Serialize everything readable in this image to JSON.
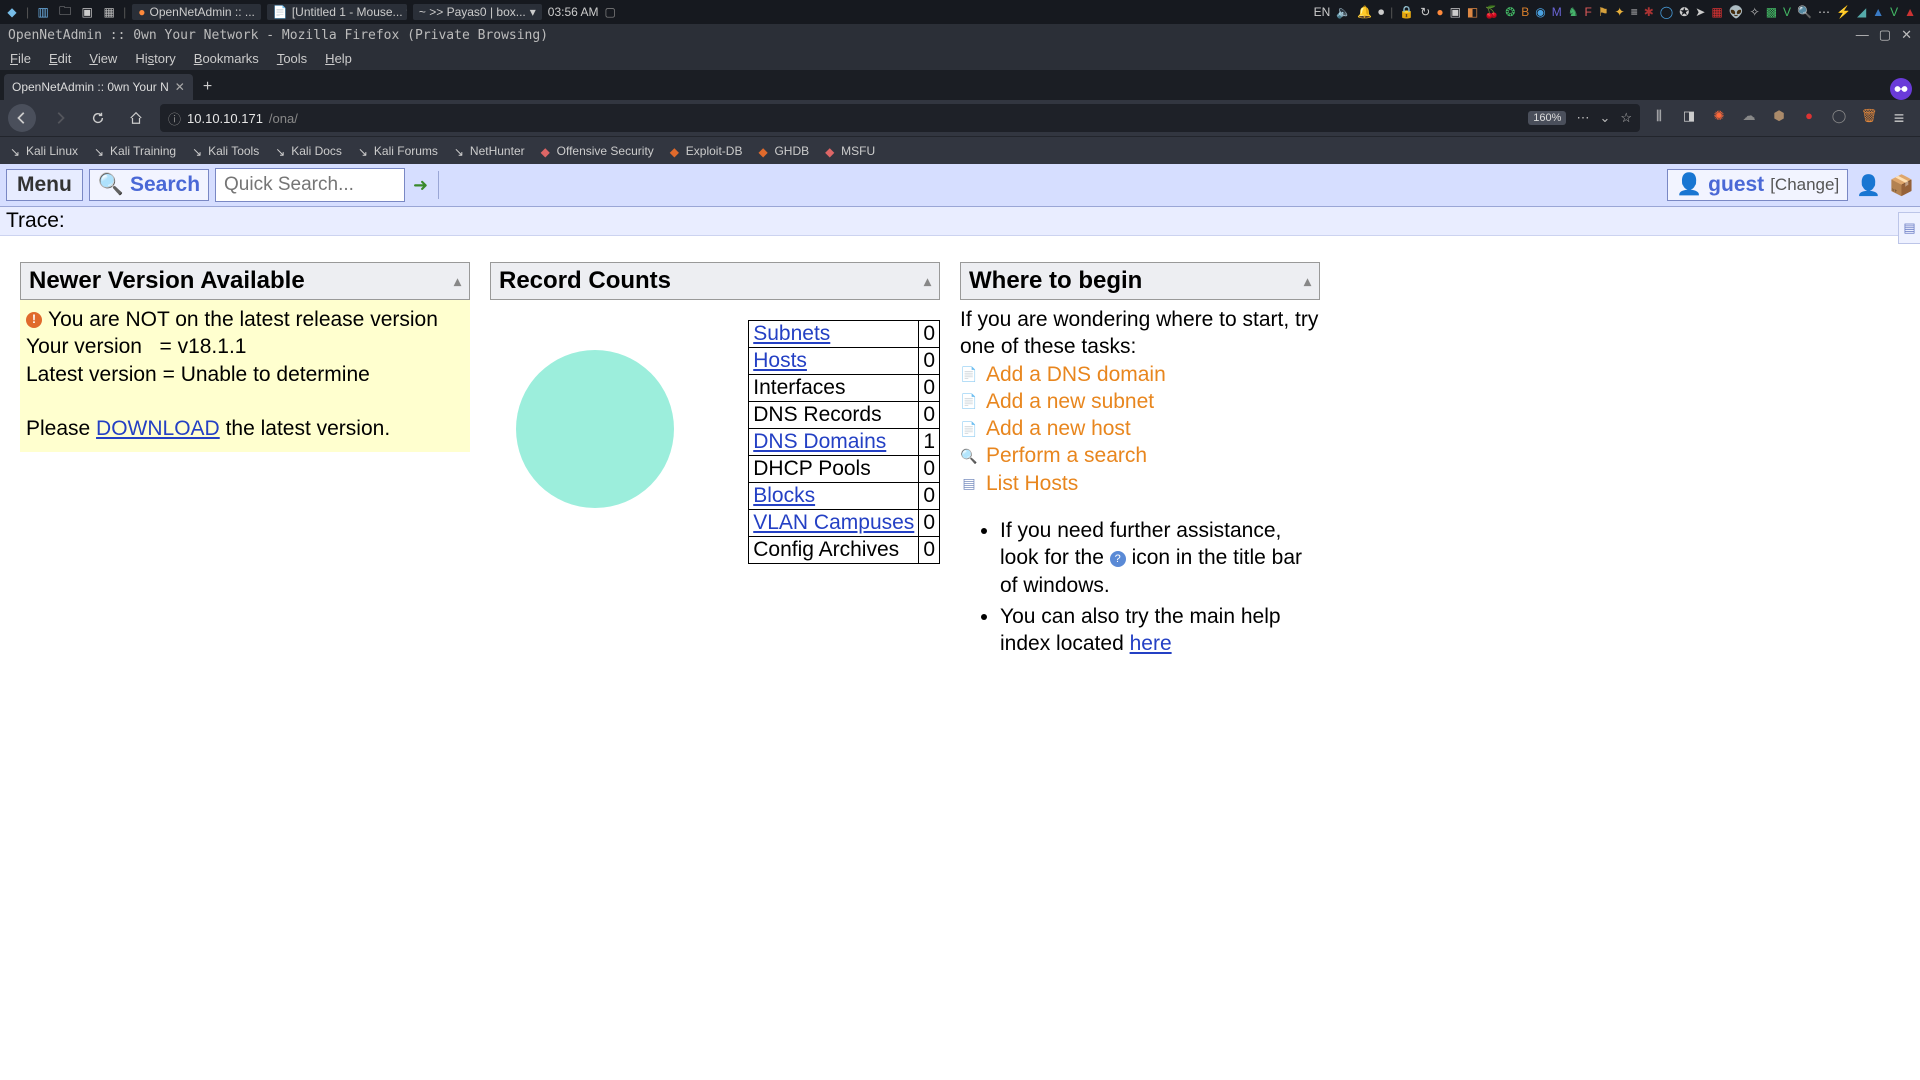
{
  "os": {
    "tasks": [
      "OpenNetAdmin :: ...",
      "[Untitled 1 - Mouse...",
      "~ >> Payas0 | box..."
    ],
    "clock": "03:56 AM",
    "lang": "EN"
  },
  "firefox": {
    "title": "OpenNetAdmin :: 0wn Your Network - Mozilla Firefox (Private Browsing)",
    "menu": [
      "File",
      "Edit",
      "View",
      "History",
      "Bookmarks",
      "Tools",
      "Help"
    ],
    "tab_title": "OpenNetAdmin :: 0wn Your N",
    "url_host": "10.10.10.171",
    "url_path": "/ona/",
    "zoom": "160%",
    "bookmarks": [
      "Kali Linux",
      "Kali Training",
      "Kali Tools",
      "Kali Docs",
      "Kali Forums",
      "NetHunter",
      "Offensive Security",
      "Exploit-DB",
      "GHDB",
      "MSFU"
    ]
  },
  "ona": {
    "menu_label": "Menu",
    "search_label": "Search",
    "quicksearch_placeholder": "Quick Search...",
    "guest_label": "guest",
    "change_label": "[Change]",
    "trace_label": "Trace:"
  },
  "version_panel": {
    "title": "Newer Version Available",
    "warn": "You are NOT on the latest release version",
    "your_version_label": "Your version",
    "your_version": "v18.1.1",
    "latest_label": "Latest version",
    "latest_value": "Unable to determine",
    "please": "Please ",
    "download": "DOWNLOAD",
    "please_tail": " the latest version."
  },
  "records_panel": {
    "title": "Record Counts",
    "rows": [
      {
        "label": "Subnets",
        "count": "0",
        "link": true
      },
      {
        "label": "Hosts",
        "count": "0",
        "link": true
      },
      {
        "label": "Interfaces",
        "count": "0",
        "link": false
      },
      {
        "label": "DNS Records",
        "count": "0",
        "link": false
      },
      {
        "label": "DNS Domains",
        "count": "1",
        "link": true
      },
      {
        "label": "DHCP Pools",
        "count": "0",
        "link": false
      },
      {
        "label": "Blocks",
        "count": "0",
        "link": true
      },
      {
        "label": "VLAN Campuses",
        "count": "0",
        "link": true
      },
      {
        "label": "Config Archives",
        "count": "0",
        "link": false
      }
    ]
  },
  "begin_panel": {
    "title": "Where to begin",
    "intro": "If you are wondering where to start, try one of these tasks:",
    "tasks": [
      "Add a DNS domain",
      "Add a new subnet",
      "Add a new host",
      "Perform a search",
      "List Hosts"
    ],
    "bullet1a": "If you need further assistance, look for the ",
    "bullet1b": " icon in the title bar of windows.",
    "bullet2a": "You can also try the main help index located ",
    "here": "here"
  }
}
